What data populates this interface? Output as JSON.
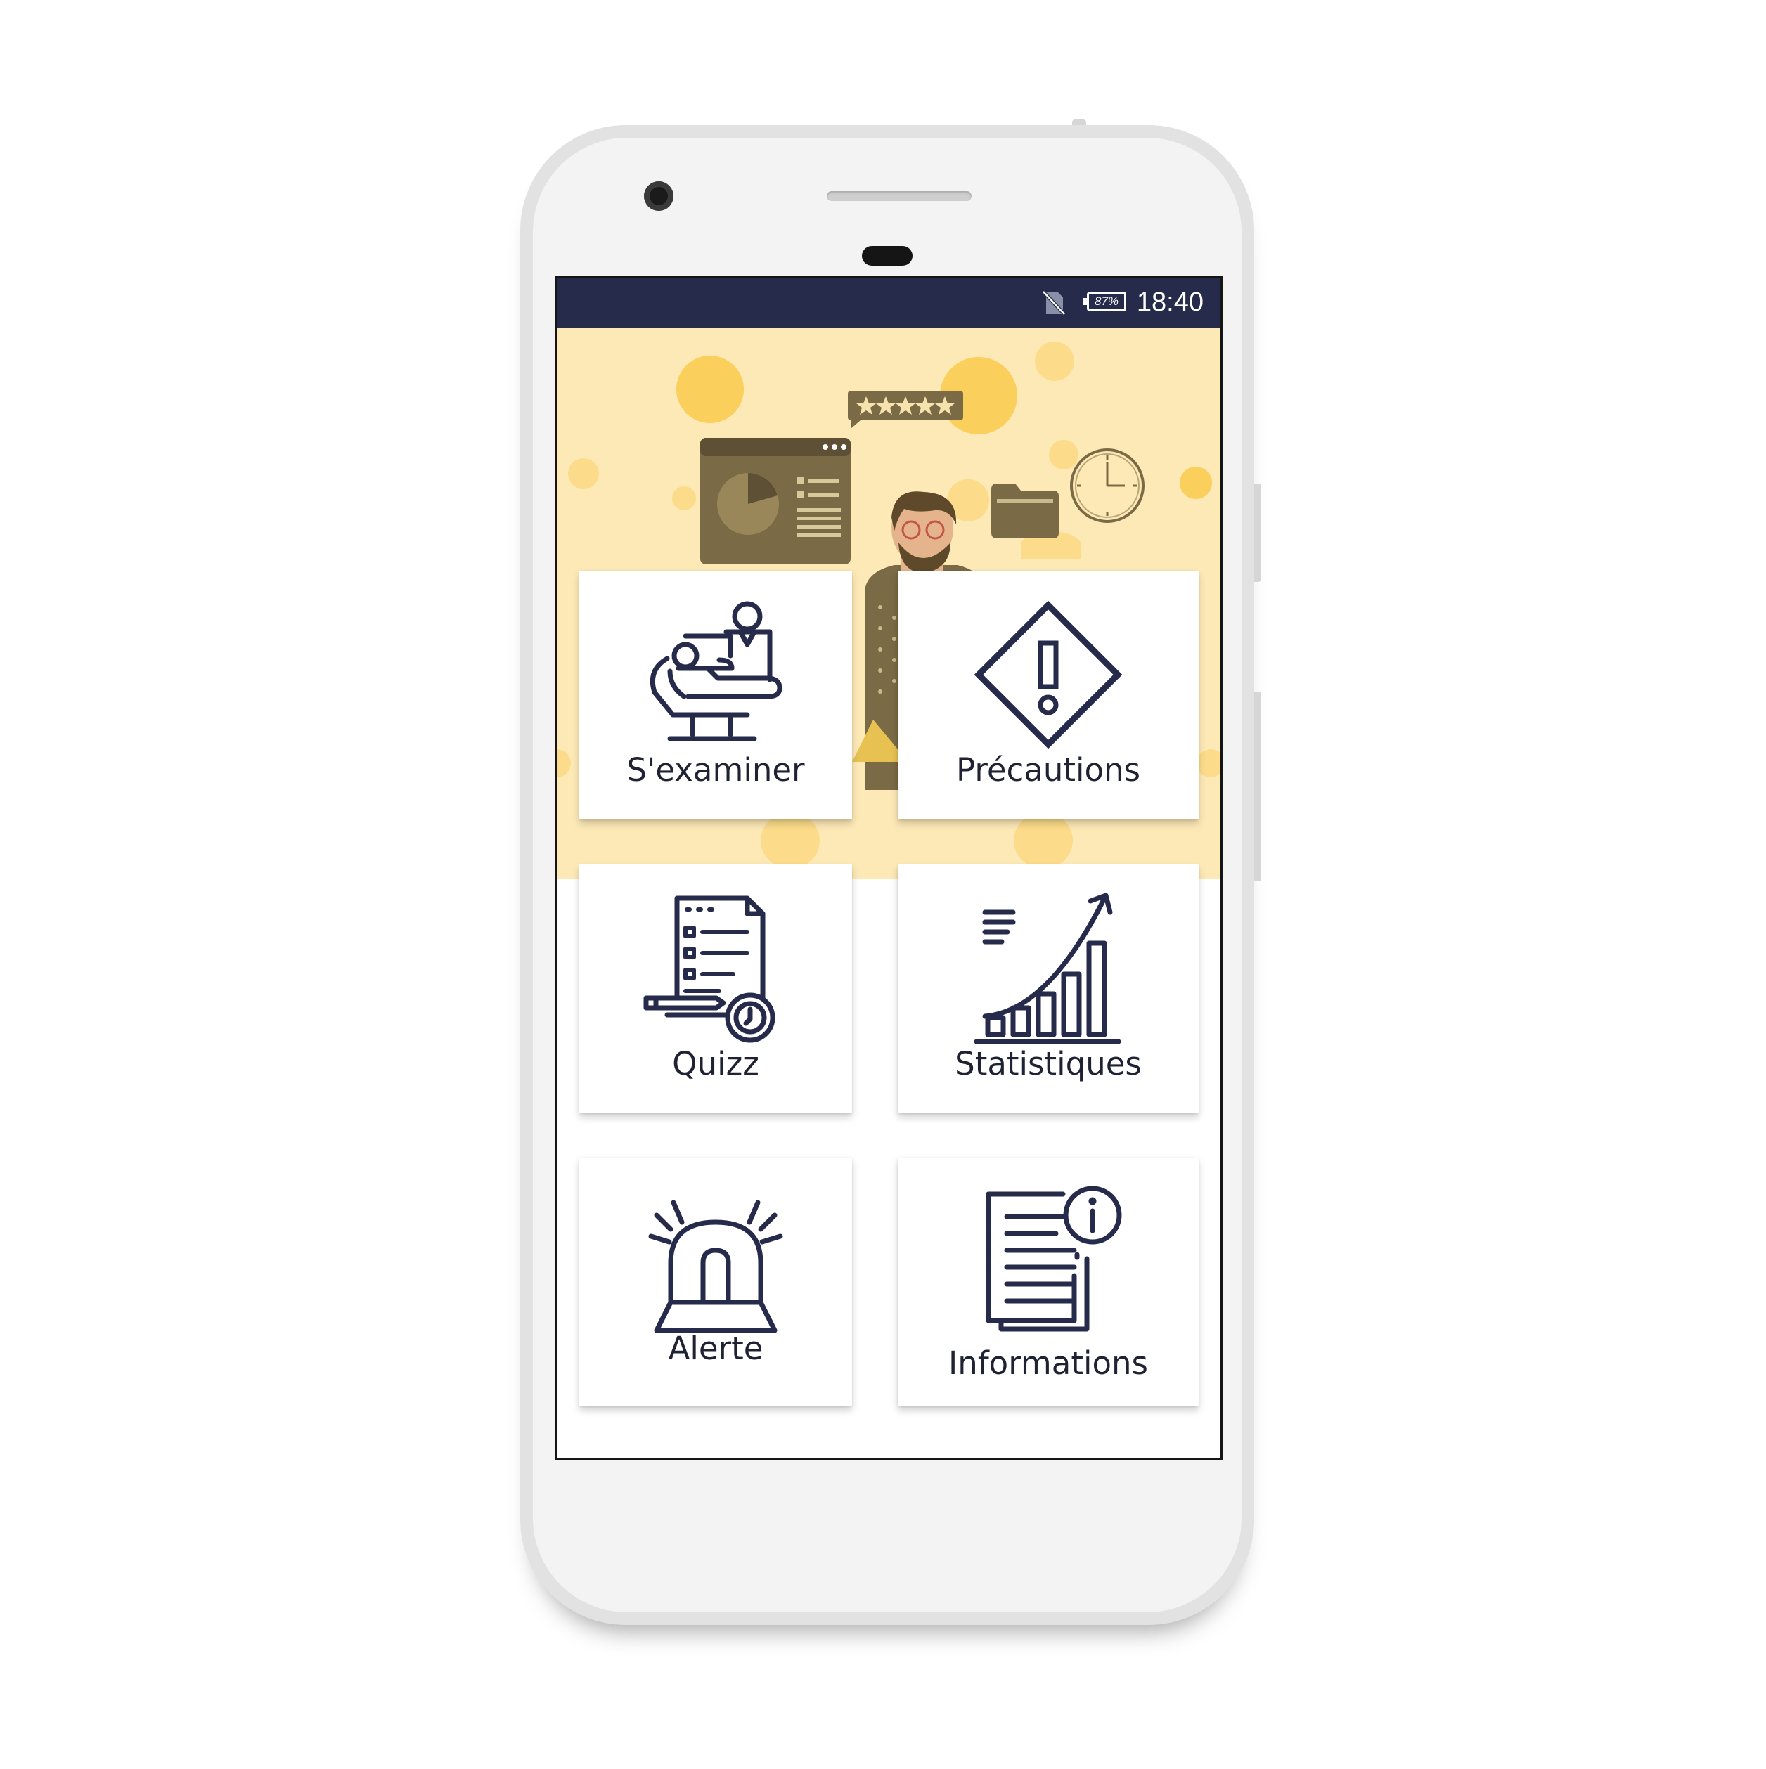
{
  "status_bar": {
    "time": "18:40",
    "battery_percent": "87%",
    "sim_icon": "no-sim-icon",
    "background_color": "#272b4b"
  },
  "banner": {
    "background_color": "#fde9b6",
    "virus_color": "#fbcf5c",
    "rating_stars": 5
  },
  "menu": {
    "items": [
      {
        "label": "S'examiner",
        "icon": "doctor-patient-icon"
      },
      {
        "label": "Précautions",
        "icon": "warning-diamond-icon"
      },
      {
        "label": "Quizz",
        "icon": "checklist-timer-icon"
      },
      {
        "label": "Statistiques",
        "icon": "growth-chart-icon"
      },
      {
        "label": "Alerte",
        "icon": "siren-icon"
      },
      {
        "label": "Informations",
        "icon": "info-document-icon"
      }
    ]
  },
  "colors": {
    "icon_stroke": "#272b4b",
    "label_text": "#1f2233"
  }
}
